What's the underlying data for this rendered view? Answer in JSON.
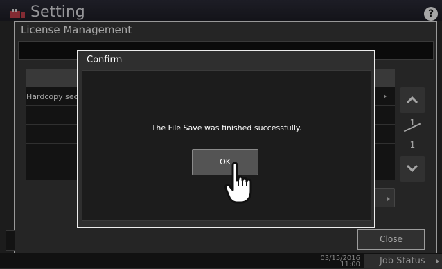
{
  "app": {
    "title": "Setting",
    "help_symbol": "?"
  },
  "license_dialog": {
    "title": "License Management",
    "rows": [
      {
        "label": "Hardcopy sec"
      },
      {
        "label": ""
      },
      {
        "label": ""
      },
      {
        "label": ""
      },
      {
        "label": ""
      }
    ],
    "pagination": {
      "current": "1",
      "total": "1"
    },
    "close_label": "Close"
  },
  "confirm": {
    "title": "Confirm",
    "message": "The File Save was finished successfully.",
    "ok_label": "OK"
  },
  "status_bar": {
    "date": "03/15/2016",
    "time": "11:00",
    "job_status_label": "Job Status"
  }
}
